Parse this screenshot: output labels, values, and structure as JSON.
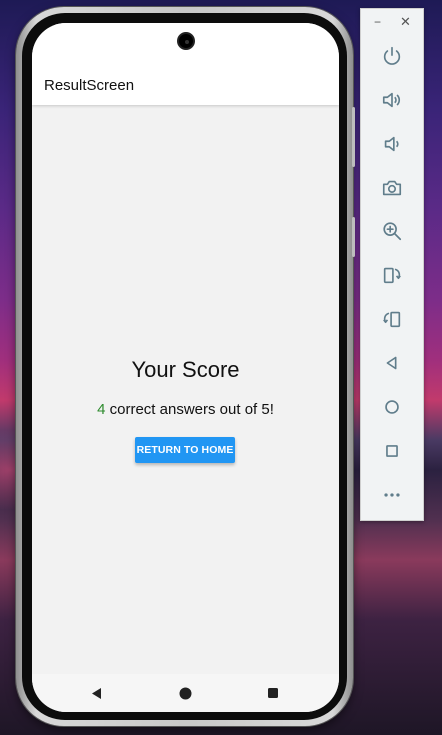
{
  "app": {
    "title": "ResultScreen"
  },
  "result": {
    "heading": "Your Score",
    "correct_count": "4",
    "summary_rest": " correct answers out of 5!",
    "home_button_label": "RETURN TO HOME"
  },
  "colors": {
    "accent": "#2196f3",
    "score_number": "#2e8b2e",
    "screen_background": "#f2f2f2"
  },
  "nav_bar": {
    "icons": [
      "back-icon",
      "home-icon",
      "overview-icon"
    ]
  },
  "emulator_toolbar": {
    "window_controls": {
      "minimize": "−",
      "close": "✕"
    },
    "tools": [
      "power-icon",
      "volume-up-icon",
      "volume-down-icon",
      "camera-icon",
      "zoom-icon",
      "rotate-left-icon",
      "rotate-right-icon",
      "back-icon",
      "home-icon",
      "overview-icon",
      "more-icon"
    ]
  }
}
